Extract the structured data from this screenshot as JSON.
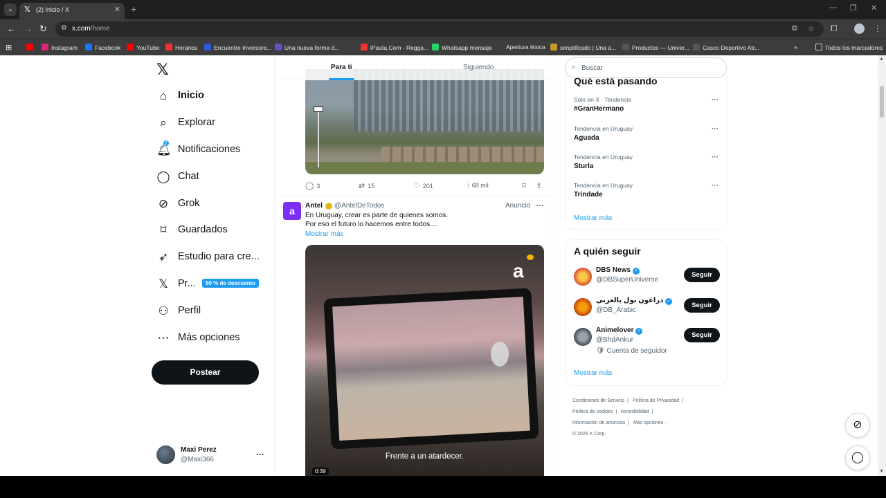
{
  "browser": {
    "tab_title": "(2) Inicio / X",
    "url_host": "x.com",
    "url_path": "/home",
    "bookmarks": [
      "Instagram",
      "Facebook",
      "YouTube",
      "Horarios",
      "Encuentre Inversore...",
      "Una nueva forma d...",
      "iPauta.Com - Regga...",
      "Whatsapp mensaje",
      "Apertura léxica",
      "simplificado | Una a...",
      "Productos — Univer...",
      "Casco Deportivo Atr..."
    ],
    "all_bookmarks": "Todos los marcadores"
  },
  "nav": {
    "home": "Inicio",
    "explore": "Explorar",
    "notifications": "Notificaciones",
    "notifications_count": "2",
    "chat": "Chat",
    "grok": "Grok",
    "bookmarks": "Guardados",
    "creator_studio": "Estudio para cre...",
    "premium": "Pr...",
    "premium_promo": "50 % de descuento",
    "profile": "Perfil",
    "more": "Más opciones",
    "post_button": "Postear"
  },
  "user": {
    "name": "Maxi Perez",
    "handle": "@Maxi366"
  },
  "feed": {
    "tabs": [
      "Para ti",
      "Siguiendo"
    ],
    "prev_tweet_actions": {
      "replies": "3",
      "reposts": "15",
      "likes": "201",
      "views": "68 mil"
    },
    "ad": {
      "avatar_letter": "a",
      "name": "Antel",
      "handle": "@AntelDeTodos",
      "label": "Anuncio",
      "text_line1": "En Uruguay, crear es parte de quienes somos.",
      "text_line2": "Por eso el futuro lo hacemos entre todos....",
      "show_more": "Mostrar más",
      "video_logo": "a",
      "video_caption": "Frente a un atardecer.",
      "video_duration": "0:39"
    }
  },
  "sidebar": {
    "search_placeholder": "Buscar",
    "trends_title": "Qué está pasando",
    "trends": [
      {
        "meta": "Solo en X · Tendencia",
        "name": "#GranHermano"
      },
      {
        "meta": "Tendencia en Uruguay",
        "name": "Aguada"
      },
      {
        "meta": "Tendencia en Uruguay",
        "name": "Sturla"
      },
      {
        "meta": "Tendencia en Uruguay",
        "name": "Trindade"
      }
    ],
    "trends_show_more": "Mostrar más",
    "follow_title": "A quién seguir",
    "suggestions": [
      {
        "name": "DBS News",
        "handle": "@DBSuperUniverse",
        "button": "Seguir",
        "extra": ""
      },
      {
        "name": "دراغون بول بالعربي",
        "handle": "@DB_Arabic",
        "button": "Seguir",
        "extra": ""
      },
      {
        "name": "Animelover",
        "handle": "@BhdAnkur",
        "button": "Seguir",
        "extra": "Cuenta de seguidor"
      }
    ],
    "follow_show_more": "Mostrar más",
    "footer": {
      "terms": "Condiciones de Servicio",
      "privacy": "Política de Privacidad",
      "cookies": "Política de cookies",
      "accessibility": "Accesibilidad",
      "ads_info": "Información de anuncios",
      "more": "Más opciones ···",
      "copyright": "© 2026 X Corp."
    }
  },
  "colors": {
    "accent": "#1d9bf0",
    "text": "#0f1419",
    "muted": "#536471",
    "ad_brand": "#7b2ff7"
  }
}
